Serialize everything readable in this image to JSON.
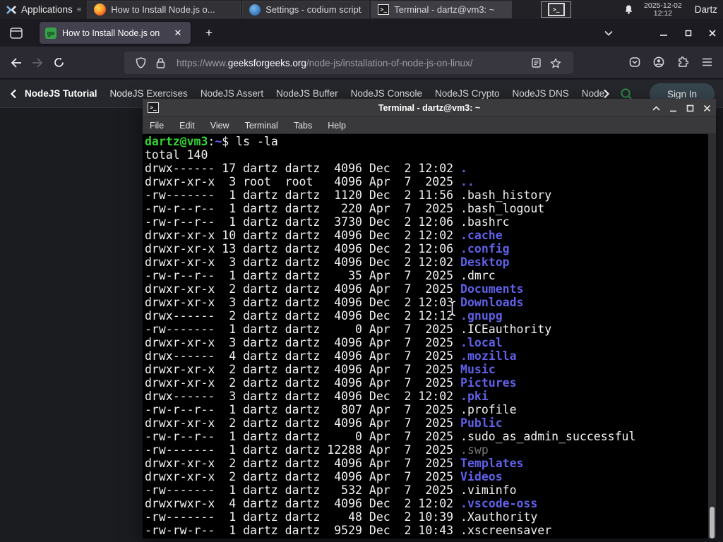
{
  "taskbar": {
    "applications_label": "Applications",
    "windows": [
      {
        "title": "How to Install Node.js o...",
        "icon": "firefox"
      },
      {
        "title": "Settings - codium script...",
        "icon": "vscodium"
      },
      {
        "title": "Terminal - dartz@vm3: ~",
        "icon": "terminal"
      }
    ],
    "clock_date": "2025-12-02",
    "clock_time": "12:12",
    "user_label": "Dartz"
  },
  "browser": {
    "tab_title": "How to Install Node.js on",
    "new_tab_label": "+",
    "url_scheme": "https://www.",
    "url_domain": "geeksforgeeks.org",
    "url_path": "/node-js/installation-of-node-js-on-linux/",
    "favicon_text": "ge"
  },
  "site_nav": {
    "items": [
      "NodeJS Tutorial",
      "NodeJS Exercises",
      "NodeJS Assert",
      "NodeJS Buffer",
      "NodeJS Console",
      "NodeJS Crypto",
      "NodeJS DNS",
      "Node"
    ],
    "sign_in_label": "Sign In"
  },
  "terminal": {
    "title": "Terminal - dartz@vm3: ~",
    "menu_items": [
      "File",
      "Edit",
      "View",
      "Terminal",
      "Tabs",
      "Help"
    ],
    "prompt_user_host": "dartz@vm3",
    "prompt_separator": ":",
    "prompt_path": "~",
    "prompt_command": "$ ls -la",
    "total_line": "total 140",
    "colors": {
      "prompt_green": "#33d133",
      "dir_blue": "#6060e8",
      "dim_gray": "#757575",
      "foreground": "#f2f2f2",
      "background": "#000000"
    },
    "listing": [
      {
        "meta": "drwx------ 17 dartz dartz  4096 Dec  2 12:02 ",
        "name": ".",
        "type": "dir"
      },
      {
        "meta": "drwxr-xr-x  3 root  root   4096 Apr  7  2025 ",
        "name": "..",
        "type": "dir"
      },
      {
        "meta": "-rw-------  1 dartz dartz  1120 Dec  2 11:56 ",
        "name": ".bash_history",
        "type": "file"
      },
      {
        "meta": "-rw-r--r--  1 dartz dartz   220 Apr  7  2025 ",
        "name": ".bash_logout",
        "type": "file"
      },
      {
        "meta": "-rw-r--r--  1 dartz dartz  3730 Dec  2 12:06 ",
        "name": ".bashrc",
        "type": "file"
      },
      {
        "meta": "drwxr-xr-x 10 dartz dartz  4096 Dec  2 12:02 ",
        "name": ".cache",
        "type": "dir"
      },
      {
        "meta": "drwxr-xr-x 13 dartz dartz  4096 Dec  2 12:06 ",
        "name": ".config",
        "type": "dir"
      },
      {
        "meta": "drwxr-xr-x  3 dartz dartz  4096 Dec  2 12:02 ",
        "name": "Desktop",
        "type": "dir"
      },
      {
        "meta": "-rw-r--r--  1 dartz dartz    35 Apr  7  2025 ",
        "name": ".dmrc",
        "type": "file"
      },
      {
        "meta": "drwxr-xr-x  2 dartz dartz  4096 Apr  7  2025 ",
        "name": "Documents",
        "type": "dir"
      },
      {
        "meta": "drwxr-xr-x  3 dartz dartz  4096 Dec  2 12:03 ",
        "name": "Downloads",
        "type": "dir"
      },
      {
        "meta": "drwx------  2 dartz dartz  4096 Dec  2 12:12 ",
        "name": ".gnupg",
        "type": "dir"
      },
      {
        "meta": "-rw-------  1 dartz dartz     0 Apr  7  2025 ",
        "name": ".ICEauthority",
        "type": "file"
      },
      {
        "meta": "drwxr-xr-x  3 dartz dartz  4096 Apr  7  2025 ",
        "name": ".local",
        "type": "dir"
      },
      {
        "meta": "drwx------  4 dartz dartz  4096 Apr  7  2025 ",
        "name": ".mozilla",
        "type": "dir"
      },
      {
        "meta": "drwxr-xr-x  2 dartz dartz  4096 Apr  7  2025 ",
        "name": "Music",
        "type": "dir"
      },
      {
        "meta": "drwxr-xr-x  2 dartz dartz  4096 Apr  7  2025 ",
        "name": "Pictures",
        "type": "dir"
      },
      {
        "meta": "drwx------  3 dartz dartz  4096 Dec  2 12:02 ",
        "name": ".pki",
        "type": "dir"
      },
      {
        "meta": "-rw-r--r--  1 dartz dartz   807 Apr  7  2025 ",
        "name": ".profile",
        "type": "file"
      },
      {
        "meta": "drwxr-xr-x  2 dartz dartz  4096 Apr  7  2025 ",
        "name": "Public",
        "type": "dir"
      },
      {
        "meta": "-rw-r--r--  1 dartz dartz     0 Apr  7  2025 ",
        "name": ".sudo_as_admin_successful",
        "type": "file"
      },
      {
        "meta": "-rw-------  1 dartz dartz 12288 Apr  7  2025 ",
        "name": ".swp",
        "type": "dim"
      },
      {
        "meta": "drwxr-xr-x  2 dartz dartz  4096 Apr  7  2025 ",
        "name": "Templates",
        "type": "dir"
      },
      {
        "meta": "drwxr-xr-x  2 dartz dartz  4096 Apr  7  2025 ",
        "name": "Videos",
        "type": "dir"
      },
      {
        "meta": "-rw-------  1 dartz dartz   532 Apr  7  2025 ",
        "name": ".viminfo",
        "type": "file"
      },
      {
        "meta": "drwxrwxr-x  4 dartz dartz  4096 Dec  2 12:02 ",
        "name": ".vscode-oss",
        "type": "dir"
      },
      {
        "meta": "-rw-------  1 dartz dartz    48 Dec  2 10:39 ",
        "name": ".Xauthority",
        "type": "file"
      },
      {
        "meta": "-rw-rw-r--  1 dartz dartz  9529 Dec  2 10:43 ",
        "name": ".xscreensaver",
        "type": "file"
      }
    ]
  }
}
